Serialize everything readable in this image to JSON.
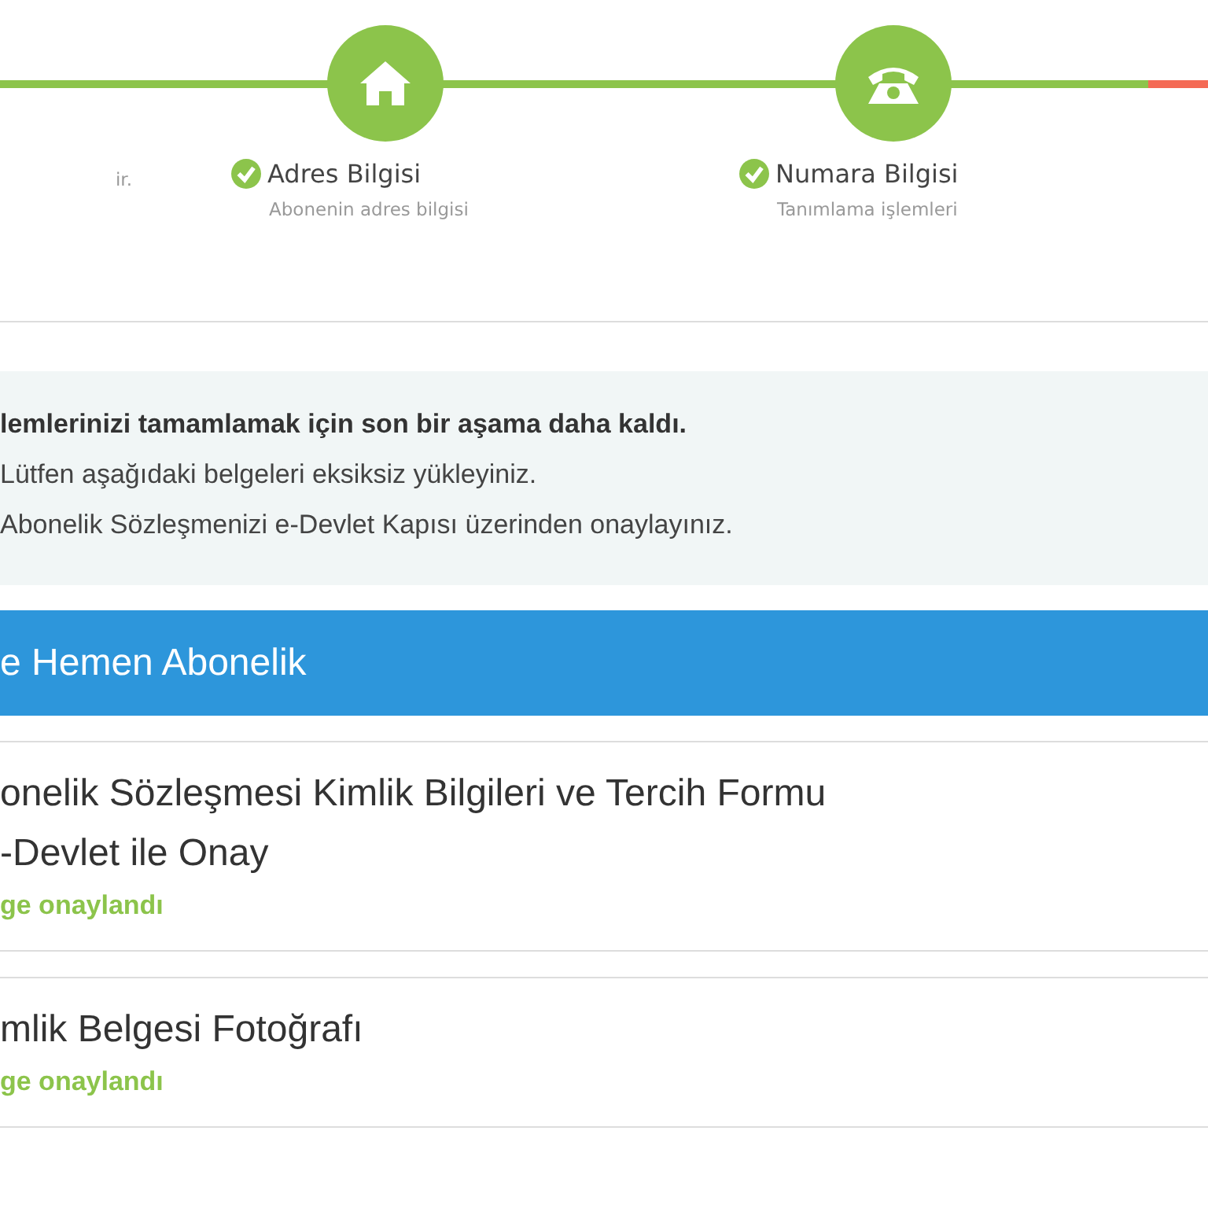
{
  "progress": {
    "level": 0.95
  },
  "steps": [
    {
      "kind": "cut",
      "subtitle": "ir."
    },
    {
      "kind": "address",
      "title": "Adres Bilgisi",
      "subtitle": "Abonenin adres bilgisi"
    },
    {
      "kind": "number",
      "title": "Numara Bilgisi",
      "subtitle": "Tanımlama işlemleri"
    }
  ],
  "notice": {
    "heading": "lemlerinizi tamamlamak için son bir aşama daha kaldı.",
    "lines": [
      "Lütfen aşağıdaki belgeleri eksiksiz yükleyiniz.",
      "Abonelik Sözleşmenizi e-Devlet Kapısı üzerinden onaylayınız."
    ]
  },
  "section": {
    "title": "e Hemen Abonelik"
  },
  "documents": [
    {
      "title_lines": [
        "onelik Sözleşmesi Kimlik Bilgileri ve Tercih Formu",
        "-Devlet ile Onay"
      ],
      "status": "ge onaylandı",
      "approved": true
    },
    {
      "title_lines": [
        "mlik Belgesi Fotoğrafı"
      ],
      "status": "ge onaylandı",
      "approved": true
    }
  ]
}
